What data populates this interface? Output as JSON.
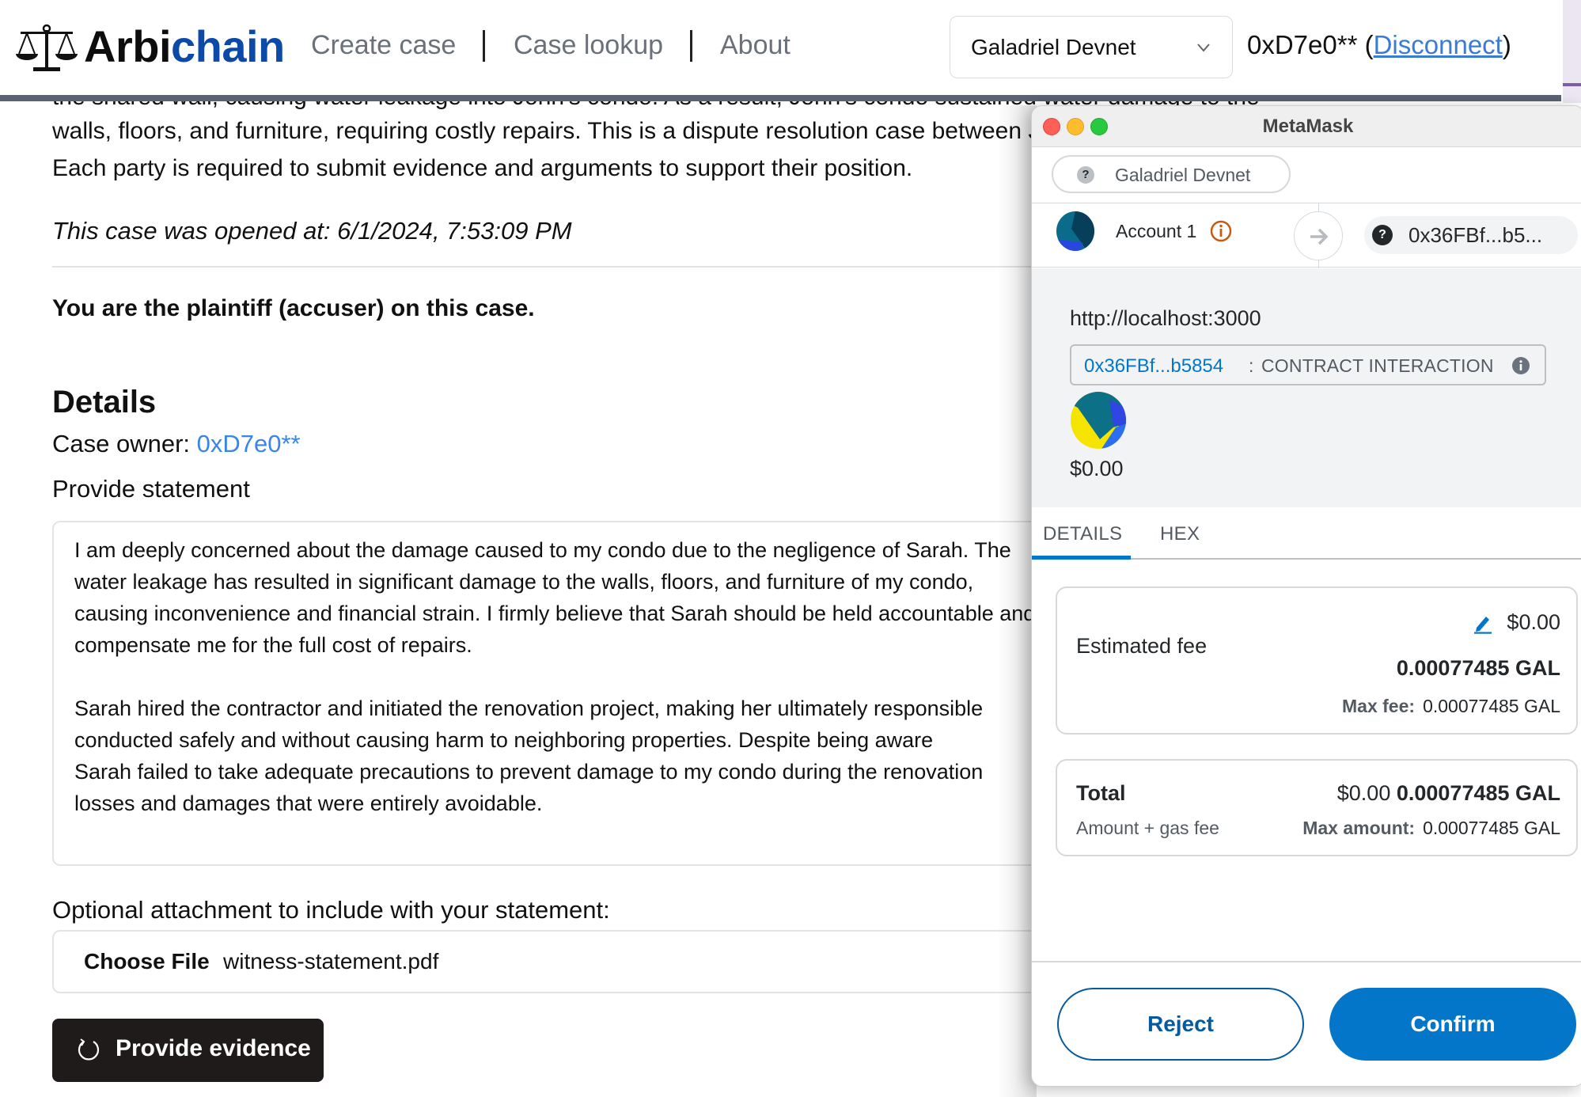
{
  "header": {
    "brand_part1": "Arbi",
    "brand_part2": "chain",
    "nav": [
      {
        "label": "Create case"
      },
      {
        "label": "Case lookup"
      },
      {
        "label": "About"
      }
    ],
    "network_select": {
      "value": "Galadriel Devnet",
      "icon": "chevron-down-icon"
    },
    "account_prefix": "0xD7e0** (",
    "disconnect_label": "Disconnect",
    "account_suffix": ")"
  },
  "case": {
    "cut_line": "the shared wall, causing water leakage into John's condo. As a result, John's condo sustained water damage to the",
    "description_lines": [
      "walls, floors, and furniture, requiring costly repairs. This is a dispute resolution case between John and Sarah.",
      "Each party is required to submit evidence and arguments to support their position."
    ],
    "opened_at": "This case was opened at: 6/1/2024, 7:53:09 PM",
    "role": "You are the plaintiff (accuser) on this case.",
    "details_heading": "Details",
    "owner_label": "Case owner: ",
    "owner_value": "0xD7e0**",
    "statement_label": "Provide statement",
    "statement_lines": [
      "I am deeply concerned about the damage caused to my condo due to the negligence of Sarah. The",
      "water leakage has resulted in significant damage to the walls, floors, and furniture of my condo,",
      "causing inconvenience and financial strain. I firmly believe that Sarah should be held accountable and",
      "compensate me for the full cost of repairs.",
      "",
      "Sarah hired the contractor and initiated the renovation project, making her ultimately responsible",
      "conducted safely and without causing harm to neighboring properties. Despite being aware",
      "Sarah failed to take adequate precautions to prevent damage to my condo during the renovation",
      "losses and damages that were entirely avoidable."
    ],
    "attachment_label": "Optional attachment to include with your statement:",
    "choose_file_label": "Choose File",
    "file_name": "witness-statement.pdf",
    "submit_label": "Provide evidence",
    "submit_icon": "loading-spinner-icon"
  },
  "metamask": {
    "window_title": "MetaMask",
    "network": "Galadriel Devnet",
    "network_icon": "question-icon",
    "account_name": "Account 1",
    "account_info_icon": "info-icon",
    "destination": "0x36FBf...b5...",
    "origin": "http://localhost:3000",
    "contract_address": "0x36FBf...b5854",
    "contract_separator": ":",
    "contract_type": "CONTRACT INTERACTION",
    "amount": "$0.00",
    "tabs": [
      {
        "label": "DETAILS",
        "active": true
      },
      {
        "label": "HEX",
        "active": false
      }
    ],
    "fee": {
      "label": "Estimated fee",
      "usd": "$0.00",
      "native": "0.00077485 GAL",
      "max_label": "Max fee:",
      "max_value": "0.00077485 GAL"
    },
    "total": {
      "label": "Total",
      "sublabel": "Amount + gas fee",
      "usd": "$0.00",
      "native": "0.00077485 GAL",
      "max_label": "Max amount:",
      "max_value": "0.00077485 GAL"
    },
    "reject_label": "Reject",
    "confirm_label": "Confirm",
    "colors": {
      "primary": "#0376c9",
      "brand_blue": "#0b4aa8",
      "link": "#3a7bd5"
    }
  }
}
